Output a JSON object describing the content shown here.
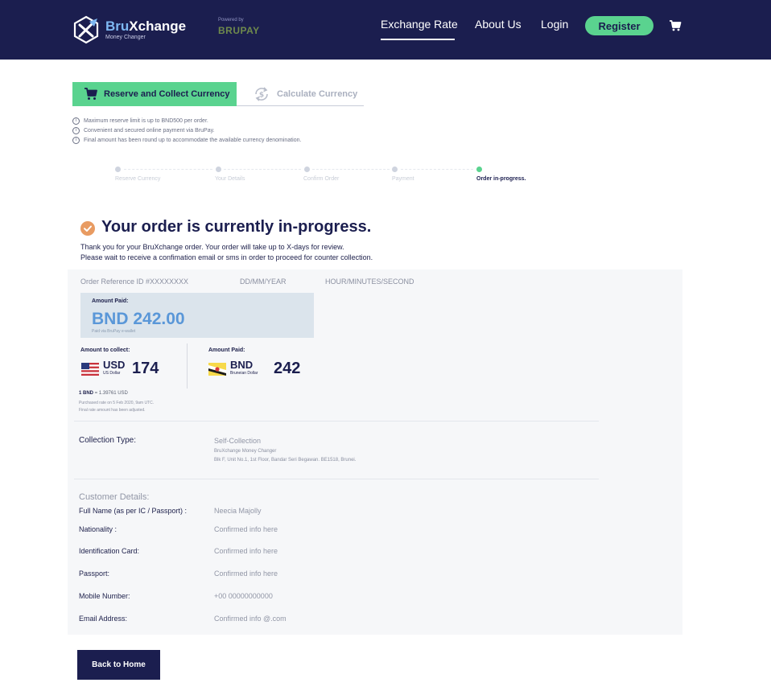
{
  "brand": {
    "name_part1": "Bru",
    "name_part2": "Xchange",
    "tagline": "Money Changer",
    "powered_by": "Powered by",
    "partner": "BRUPAY"
  },
  "nav": {
    "exchange_rate": "Exchange Rate",
    "about_us": "About Us",
    "login": "Login",
    "register": "Register"
  },
  "tabs": {
    "reserve": "Reserve and Collect Currency",
    "calculate": "Calculate Currency"
  },
  "notes": [
    "Maximum reserve limit is up to BND500 per order.",
    "Convenient and secured online payment via BruPay.",
    "Final amount has been round up to accommodate the available currency denomination."
  ],
  "steps": [
    {
      "label": "Reserve Currency"
    },
    {
      "label": "Your Details"
    },
    {
      "label": "Confirm Order"
    },
    {
      "label": "Payment"
    },
    {
      "label": "Order in-progress."
    }
  ],
  "status": {
    "heading": "Your order is currently in-progress.",
    "line1": "Thank you for your BruXchange order. Your order will take up to X-days for review.",
    "line2": "Please wait to receive a confimation email or sms in order to proceed for counter collection."
  },
  "order": {
    "reference": "Order Reference ID #XXXXXXXX",
    "date": "DD/MM/YEAR",
    "time": "HOUR/MINUTES/SECOND",
    "paid_title": "Amount Paid:",
    "paid_amount": "BND 242.00",
    "paid_note": "Paid via BruPay e-wallet",
    "collect_title": "Amount to collect:",
    "collect_code": "USD",
    "collect_name": "US Dollar",
    "collect_value": "174",
    "paid2_title": "Amount Paid:",
    "paid2_code": "BND",
    "paid2_name": "Bruneian Dollar",
    "paid2_value": "242",
    "rate_base": "1 BND",
    "rate_rest": " = 1.39761 USD",
    "rate_note1": "Purchased rate on 5 Feb 2020, 9am UTC.",
    "rate_note2": "Final rate amount has been adjusted."
  },
  "collection": {
    "label": "Collection Type:",
    "value": "Self-Collection",
    "branch": "BruXchange Money Changer",
    "address": "Blk F, Unit No.1, 1st Floor, Bandar Seri Begawan. BE1518, Brunei."
  },
  "customer": {
    "title": "Customer Details:",
    "fields": [
      {
        "label": "Full Name (as per IC / Passport) :",
        "value": "Neecia Majolly"
      },
      {
        "label": "Nationality :",
        "value": "Confirmed info here"
      },
      {
        "label": "Identification Card:",
        "value": "Confirmed info here"
      },
      {
        "label": "Passport:",
        "value": "Confirmed info here"
      },
      {
        "label": "Mobile Number:",
        "value": "+00 00000000000"
      },
      {
        "label": "Email Address:",
        "value": "Confirmed info @.com"
      }
    ]
  },
  "actions": {
    "back_home": "Back to Home"
  },
  "colors": {
    "navy": "#1b1e4f",
    "green": "#5ad38f",
    "blue_amount": "#5a97d8",
    "check_orange": "#e89b62"
  }
}
